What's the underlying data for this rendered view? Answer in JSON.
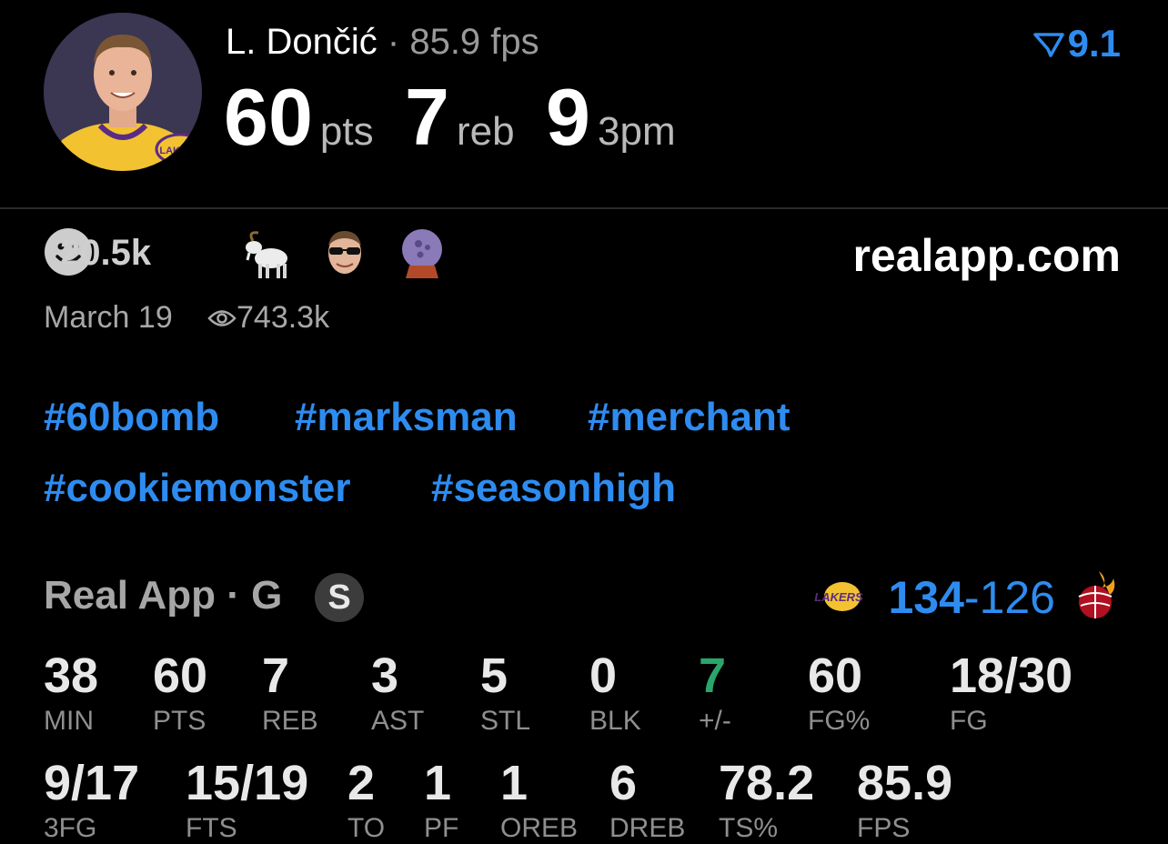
{
  "header": {
    "player_name": "L. Dončić",
    "separator": "·",
    "fps_text": "85.9 fps",
    "rating": "9.1",
    "big_stats": [
      {
        "value": "60",
        "unit": "pts"
      },
      {
        "value": "7",
        "unit": "reb"
      },
      {
        "value": "9",
        "unit": "3pm"
      }
    ]
  },
  "social": {
    "reaction_count": "20.5k",
    "reactions": [
      "smiley-icon",
      "goat-icon",
      "player-sunglasses-icon",
      "crystal-ball-icon"
    ],
    "site": "realapp.com",
    "date": "March 19",
    "views": "743.3k"
  },
  "hashtags": [
    "#60bomb",
    "#marksman",
    "#merchant",
    "#cookiemonster",
    "#seasonhigh"
  ],
  "game": {
    "title": "Real App · G",
    "badge": "S",
    "score_home": "134",
    "score_sep": "-",
    "score_away": "126"
  },
  "stats_row1": [
    {
      "value": "38",
      "label": "MIN"
    },
    {
      "value": "60",
      "label": "PTS"
    },
    {
      "value": "7",
      "label": "REB"
    },
    {
      "value": "3",
      "label": "AST"
    },
    {
      "value": "5",
      "label": "STL"
    },
    {
      "value": "0",
      "label": "BLK"
    },
    {
      "value": "7",
      "label": "+/-"
    },
    {
      "value": "60",
      "label": "FG%"
    },
    {
      "value": "18/30",
      "label": "FG"
    }
  ],
  "stats_row2": [
    {
      "value": "9/17",
      "label": "3FG"
    },
    {
      "value": "15/19",
      "label": "FTS"
    },
    {
      "value": "2",
      "label": "TO"
    },
    {
      "value": "1",
      "label": "PF"
    },
    {
      "value": "1",
      "label": "OREB"
    },
    {
      "value": "6",
      "label": "DREB"
    },
    {
      "value": "78.2",
      "label": "TS%"
    },
    {
      "value": "85.9",
      "label": "FPS"
    }
  ],
  "colors": {
    "accent_blue": "#2e8cf0",
    "positive_green": "#2aa56b",
    "background": "#000000"
  }
}
